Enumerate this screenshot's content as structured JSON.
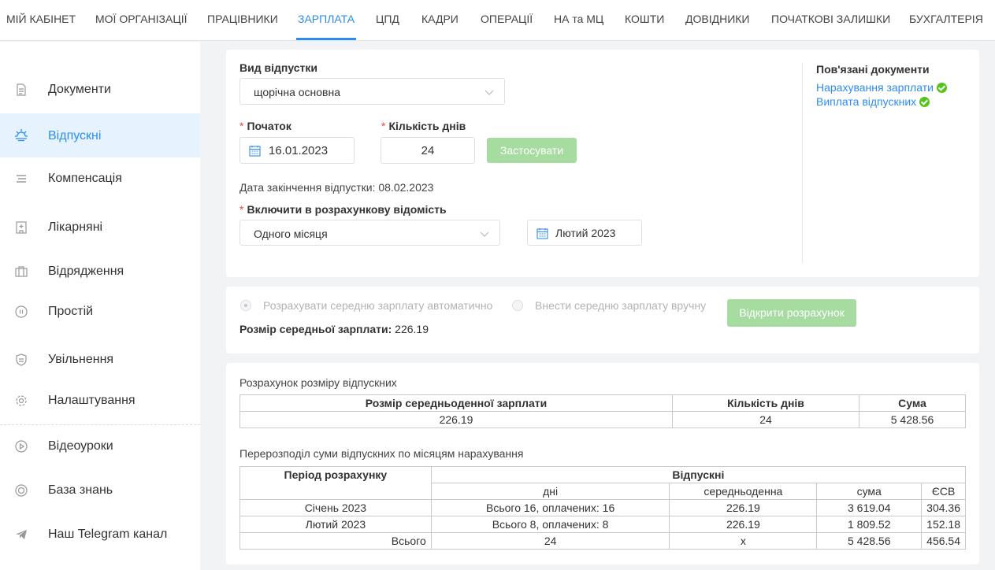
{
  "nav": {
    "items": [
      "МІЙ КАБІНЕТ",
      "МОЇ ОРГАНІЗАЦІЇ",
      "ПРАЦІВНИКИ",
      "ЗАРПЛАТА",
      "ЦПД",
      "КАДРИ",
      "ОПЕРАЦІЇ",
      "НА та МЦ",
      "КОШТИ",
      "ДОВІДНИКИ",
      "ПОЧАТКОВІ ЗАЛИШКИ",
      "БУХГАЛТЕРІЯ"
    ],
    "active": "ЗАРПЛАТА"
  },
  "sidebar": {
    "items": [
      {
        "label": "Документи",
        "icon": "document-icon"
      },
      {
        "label": "Відпускні",
        "icon": "sunrise-icon",
        "active": true
      },
      {
        "label": "Компенсація",
        "icon": "list-icon"
      },
      {
        "label": "Лікарняні",
        "icon": "hospital-icon"
      },
      {
        "label": "Відрядження",
        "icon": "briefcase-icon"
      },
      {
        "label": "Простій",
        "icon": "pause-icon"
      },
      {
        "label": "Увільнення",
        "icon": "shield-icon"
      },
      {
        "label": "Налаштування",
        "icon": "gear-icon"
      },
      {
        "label": "Відеоуроки",
        "icon": "play-icon"
      },
      {
        "label": "База знань",
        "icon": "lifebuoy-icon"
      },
      {
        "label": "Наш Telegram канал",
        "icon": "telegram-icon"
      }
    ]
  },
  "form": {
    "vacation_type_label": "Вид відпустки",
    "vacation_type_value": "щорічна основна",
    "start_label": "Початок",
    "start_value": "16.01.2023",
    "days_label": "Кількість днів",
    "days_value": "24",
    "apply_label": "Застосувати",
    "end_date_text": "Дата закінчення відпустки: 08.02.2023",
    "include_label": "Включити в розрахункову відомість",
    "include_value": "Одного місяця",
    "month_value": "Лютий 2023"
  },
  "related": {
    "title": "Пов'язані документи",
    "links": [
      "Нарахування зарплати",
      "Виплата відпускних"
    ]
  },
  "avg": {
    "auto_label": "Розрахувати середню зарплату автоматично",
    "manual_label": "Внести середню зарплату вручну",
    "open_label": "Відкрити розрахунок",
    "size_label": "Розмір середньої зарплати:",
    "size_value": "226.19"
  },
  "calc": {
    "title": "Розрахунок розміру відпускних",
    "headers": [
      "Розмір середньоденної зарплати",
      "Кількість днів",
      "Сума"
    ],
    "row": [
      "226.19",
      "24",
      "5 428.56"
    ]
  },
  "distribution": {
    "title": "Перерозподіл суми відпускних по місяцям нарахування",
    "period_header": "Період розрахунку",
    "vacation_header": "Відпускні",
    "sub_headers": [
      "дні",
      "середньоденна",
      "сума",
      "ЄСВ"
    ],
    "rows": [
      [
        "Січень 2023",
        "Всього 16, оплачених: 16",
        "226.19",
        "3 619.04",
        "304.36"
      ],
      [
        "Лютий 2023",
        "Всього 8, оплачених: 8",
        "226.19",
        "1 809.52",
        "152.18"
      ]
    ],
    "total": [
      "Всього",
      "24",
      "x",
      "5 428.56",
      "456.54"
    ]
  }
}
